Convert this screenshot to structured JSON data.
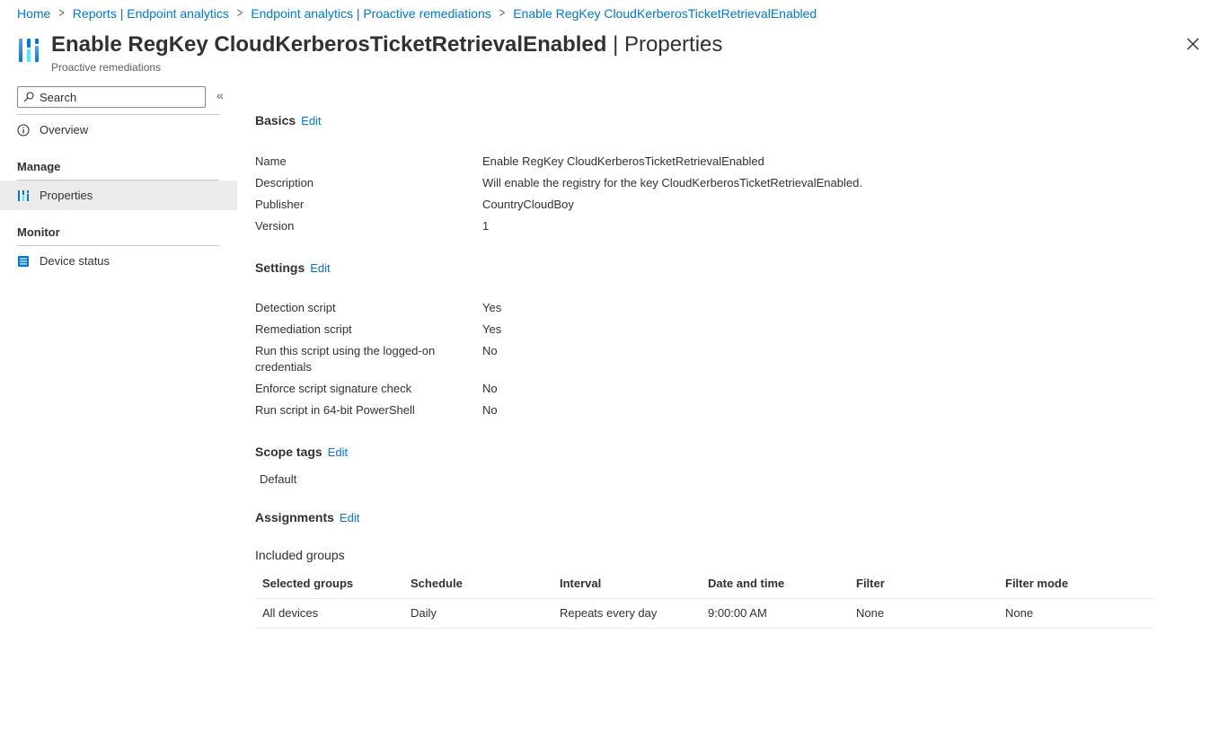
{
  "breadcrumb": [
    {
      "label": "Home"
    },
    {
      "label": "Reports | Endpoint analytics"
    },
    {
      "label": "Endpoint analytics | Proactive remediations"
    },
    {
      "label": "Enable RegKey CloudKerberosTicketRetrievalEnabled"
    }
  ],
  "header": {
    "title": "Enable RegKey CloudKerberosTicketRetrievalEnabled",
    "title_separator": "|",
    "title_suffix": "Properties",
    "subtitle": "Proactive remediations",
    "more_label": "···",
    "icon": "remediations-icon",
    "accent": "#0078d4"
  },
  "sidebar": {
    "search_placeholder": "Search",
    "collapse_label": "«",
    "overview_label": "Overview",
    "manage_heading": "Manage",
    "properties_label": "Properties",
    "monitor_heading": "Monitor",
    "device_status_label": "Device status"
  },
  "basics": {
    "heading": "Basics",
    "edit": "Edit",
    "rows": [
      {
        "label": "Name",
        "value": "Enable RegKey CloudKerberosTicketRetrievalEnabled"
      },
      {
        "label": "Description",
        "value": "Will enable the registry for the key CloudKerberosTicketRetrievalEnabled."
      },
      {
        "label": "Publisher",
        "value": "CountryCloudBoy"
      },
      {
        "label": "Version",
        "value": "1"
      }
    ]
  },
  "settings": {
    "heading": "Settings",
    "edit": "Edit",
    "rows": [
      {
        "label": "Detection script",
        "value": "Yes"
      },
      {
        "label": "Remediation script",
        "value": "Yes"
      },
      {
        "label": "Run this script using the logged-on credentials",
        "value": "No"
      },
      {
        "label": "Enforce script signature check",
        "value": "No"
      },
      {
        "label": "Run script in 64-bit PowerShell",
        "value": "No"
      }
    ]
  },
  "scope_tags": {
    "heading": "Scope tags",
    "edit": "Edit",
    "value": "Default"
  },
  "assignments": {
    "heading": "Assignments",
    "edit": "Edit",
    "included_label": "Included groups",
    "columns": [
      "Selected groups",
      "Schedule",
      "Interval",
      "Date and time",
      "Filter",
      "Filter mode"
    ],
    "rows": [
      [
        "All devices",
        "Daily",
        "Repeats every day",
        "9:00:00 AM",
        "None",
        "None"
      ]
    ]
  }
}
